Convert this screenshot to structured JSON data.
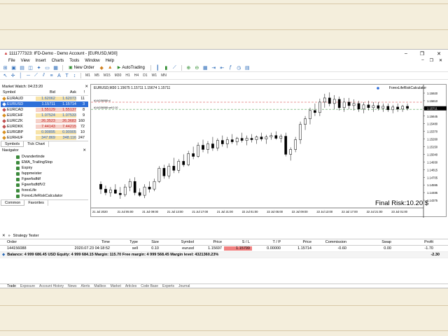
{
  "window": {
    "title": "1111777323: IFD-Demo - Demo Account - [EURUSD,M30]"
  },
  "menu": [
    "File",
    "View",
    "Insert",
    "Charts",
    "Tools",
    "Window",
    "Help"
  ],
  "toolbar": {
    "new_order": "New Order",
    "autotrading": "AutoTrading"
  },
  "timeframes": [
    "M1",
    "M5",
    "M15",
    "M30",
    "H1",
    "H4",
    "D1",
    "W1",
    "MN"
  ],
  "market_watch": {
    "title": "Market Watch: 04:23:20",
    "cols": {
      "symbol": "Symbol",
      "bid": "Bid",
      "ask": "Ask",
      "spread": "!"
    },
    "rows": [
      {
        "sym": "EURAUD",
        "bid": "1.62062",
        "ask": "1.62073",
        "sp": "11",
        "bg": "#f7e3a8",
        "bc": "#1f5fd0",
        "dot": "#d89020"
      },
      {
        "sym": "EURUSD",
        "bid": "1.15711",
        "ask": "1.15714",
        "sp": "3",
        "bg": "#2d6fd8",
        "bc": "#ffffff",
        "dot": "#ffffff",
        "selected": true
      },
      {
        "sym": "EURCAD",
        "bid": "1.55129",
        "ask": "1.55137",
        "sp": "8",
        "bg": "#f6d0c8",
        "bc": "#c02020",
        "dot": "#c05050"
      },
      {
        "sym": "EURCHF",
        "bid": "1.07524",
        "ask": "1.07533",
        "sp": "9",
        "bg": "#f7e3a8",
        "bc": "#1f5fd0",
        "dot": "#d89020"
      },
      {
        "sym": "EURCZK",
        "bid": "26.3523",
        "ask": "26.3683",
        "sp": "160",
        "bg": "#f6d0c8",
        "bc": "#c02020",
        "dot": "#c05050"
      },
      {
        "sym": "EURDKK",
        "bid": "7.44143",
        "ask": "7.44215",
        "sp": "72",
        "bg": "#f6d0c8",
        "bc": "#c02020",
        "dot": "#c05050"
      },
      {
        "sym": "EURGBP",
        "bid": "0.90895",
        "ask": "0.90905",
        "sp": "10",
        "bg": "#f7e3a8",
        "bc": "#1f5fd0",
        "dot": "#d89020"
      },
      {
        "sym": "EURHUF",
        "bid": "347.869",
        "ask": "348.116",
        "sp": "247",
        "bg": "#f7e3a8",
        "bc": "#1f5fd0",
        "dot": "#d89020"
      }
    ],
    "tabs": [
      "Symbols",
      "Tick Chart"
    ]
  },
  "navigator": {
    "title": "Navigator",
    "items": [
      "Dvandertinde",
      "EMA_TrailingStop",
      "Expiry",
      "fappmeister",
      "Fgwefsdfdf",
      "FgwefsdfdfV2",
      "forexLife",
      "ForexLifeRiskCalculator"
    ],
    "tabs": [
      "Common",
      "Favorites"
    ]
  },
  "chart": {
    "header": "EURUSD,M30  1.15675 1.15711 1.15674 1.15711",
    "indicator": "ForexLifeRiskCalculator",
    "sell_label": "#144156088 sell 0.10",
    "sl_label": "#144156088 sl",
    "final_risk": "Final Risk:10.20 $",
    "price_ticks": [
      "1.15920",
      "1.15810",
      "1.15711",
      "1.15645",
      "1.15480",
      "1.15370",
      "1.15260",
      "1.15150",
      "1.15040",
      "1.14930",
      "1.14815",
      "1.14705",
      "1.14595",
      "1.14485",
      "1.14375"
    ],
    "time_ticks": [
      "21 Jul 2020",
      "21 Jul 05:00",
      "21 Jul 09:00",
      "21 Jul 13:00",
      "21 Jul 17:00",
      "21 Jul 21:00",
      "22 Jul 01:00",
      "22 Jul 05:00",
      "22 Jul 09:00",
      "22 Jul 13:00",
      "22 Jul 17:00",
      "22 Jul 21:00",
      "23 Jul 01:00"
    ],
    "current_price": "1.15711"
  },
  "chart_data": {
    "type": "candlestick",
    "title": "EURUSD,M30",
    "ylim": [
      1.1432,
      1.1597
    ],
    "current_price": 1.15711,
    "sell_level": 1.15697,
    "sl_level": 1.15799,
    "candles": [
      [
        1.1462,
        1.1466,
        1.1448,
        1.1455
      ],
      [
        1.1455,
        1.146,
        1.1446,
        1.145
      ],
      [
        1.145,
        1.1458,
        1.1444,
        1.1454
      ],
      [
        1.1454,
        1.1462,
        1.1448,
        1.1449
      ],
      [
        1.1449,
        1.1458,
        1.1441,
        1.1447
      ],
      [
        1.1447,
        1.1462,
        1.1444,
        1.1458
      ],
      [
        1.1458,
        1.147,
        1.1452,
        1.1466
      ],
      [
        1.1466,
        1.1472,
        1.1446,
        1.145
      ],
      [
        1.145,
        1.1456,
        1.1444,
        1.1446
      ],
      [
        1.1446,
        1.1462,
        1.1442,
        1.1458
      ],
      [
        1.1458,
        1.1466,
        1.145,
        1.1455
      ],
      [
        1.1455,
        1.147,
        1.1452,
        1.1466
      ],
      [
        1.1466,
        1.1488,
        1.1464,
        1.1485
      ],
      [
        1.1485,
        1.149,
        1.147,
        1.1474
      ],
      [
        1.1474,
        1.1492,
        1.147,
        1.1488
      ],
      [
        1.1488,
        1.15,
        1.1478,
        1.1482
      ],
      [
        1.1482,
        1.1498,
        1.1478,
        1.1495
      ],
      [
        1.1495,
        1.1505,
        1.1487,
        1.149
      ],
      [
        1.149,
        1.151,
        1.1488,
        1.1506
      ],
      [
        1.1506,
        1.1516,
        1.1498,
        1.1502
      ],
      [
        1.1502,
        1.1522,
        1.15,
        1.1518
      ],
      [
        1.1518,
        1.1526,
        1.1508,
        1.1512
      ],
      [
        1.1512,
        1.1524,
        1.1506,
        1.152
      ],
      [
        1.152,
        1.153,
        1.151,
        1.1514
      ],
      [
        1.1514,
        1.1528,
        1.151,
        1.1525
      ],
      [
        1.1525,
        1.1532,
        1.1516,
        1.152
      ],
      [
        1.152,
        1.153,
        1.1514,
        1.1526
      ],
      [
        1.1526,
        1.1534,
        1.152,
        1.1523
      ],
      [
        1.1523,
        1.153,
        1.1518,
        1.1528
      ],
      [
        1.1528,
        1.1536,
        1.1522,
        1.1525
      ],
      [
        1.1525,
        1.1532,
        1.1518,
        1.1528
      ],
      [
        1.1528,
        1.1534,
        1.1522,
        1.1526
      ],
      [
        1.1526,
        1.1532,
        1.152,
        1.153
      ],
      [
        1.153,
        1.1536,
        1.1524,
        1.1527
      ],
      [
        1.1527,
        1.1533,
        1.152,
        1.153
      ],
      [
        1.153,
        1.1536,
        1.1526,
        1.1532
      ],
      [
        1.1532,
        1.1538,
        1.1526,
        1.1528
      ],
      [
        1.1528,
        1.1534,
        1.1522,
        1.1531
      ],
      [
        1.1531,
        1.1536,
        1.1502,
        1.1505
      ],
      [
        1.1505,
        1.1515,
        1.1496,
        1.1512
      ],
      [
        1.1512,
        1.153,
        1.1508,
        1.1526
      ],
      [
        1.1526,
        1.1552,
        1.152,
        1.1548
      ],
      [
        1.1548,
        1.156,
        1.154,
        1.1556
      ],
      [
        1.1556,
        1.1572,
        1.1548,
        1.1568
      ],
      [
        1.1568,
        1.1578,
        1.156,
        1.1565
      ],
      [
        1.1565,
        1.1585,
        1.156,
        1.158
      ],
      [
        1.158,
        1.1592,
        1.1572,
        1.1586
      ],
      [
        1.1586,
        1.1594,
        1.1574,
        1.1578
      ],
      [
        1.1578,
        1.159,
        1.157,
        1.1584
      ],
      [
        1.1584,
        1.1588,
        1.1568,
        1.1572
      ],
      [
        1.1572,
        1.1586,
        1.1566,
        1.158
      ],
      [
        1.158,
        1.1586,
        1.157,
        1.1575
      ],
      [
        1.1575,
        1.1584,
        1.1568,
        1.1578
      ],
      [
        1.1578,
        1.1582,
        1.1566,
        1.157
      ],
      [
        1.157,
        1.158,
        1.1564,
        1.1576
      ],
      [
        1.1576,
        1.1582,
        1.1568,
        1.1572
      ],
      [
        1.1572,
        1.158,
        1.1566,
        1.1575
      ],
      [
        1.1575,
        1.158,
        1.1568,
        1.1571
      ],
      [
        1.1571,
        1.1578,
        1.1566,
        1.1574
      ],
      [
        1.1574,
        1.1578,
        1.1566,
        1.1569
      ],
      [
        1.1569,
        1.1576,
        1.1564,
        1.1573
      ],
      [
        1.1573,
        1.1578,
        1.1566,
        1.157
      ],
      [
        1.157,
        1.1576,
        1.1566,
        1.1574
      ],
      [
        1.1574,
        1.1578,
        1.1568,
        1.1571
      ]
    ]
  },
  "tester": {
    "title": "Strategy Tester",
    "headers": [
      "Order",
      "Time",
      "Type",
      "Size",
      "Symbol",
      "Price",
      "S / L",
      "T / P",
      "Price",
      "Commission",
      "Swap",
      "Profit"
    ],
    "rows": [
      [
        "144156088",
        "2020.07.23 04:18:52",
        "sell",
        "0.10",
        "eurusd",
        "1.15697",
        "1.15799",
        "0.00000",
        "1.15714",
        "-0.60",
        "0.00",
        "-1.70"
      ]
    ],
    "balance": "Balance: 4 999 686.45 USD  Equity: 4 999 684.15  Margin: 115.70  Free margin: 4 999 568.45  Margin level: 4321360.23%",
    "balance_profit": "-2.30",
    "bottom_tabs": [
      "Trade",
      "Exposure",
      "Account History",
      "News",
      "Alerts",
      "Mailbox",
      "Market",
      "Articles",
      "Code Base",
      "Experts",
      "Journal"
    ]
  },
  "colors": {
    "sl_bg": "#f08080",
    "chart_line_red": "#d03030",
    "chart_line_green": "#2a8a2a",
    "price_label_bg": "#000000"
  }
}
